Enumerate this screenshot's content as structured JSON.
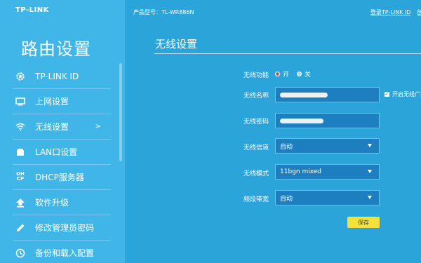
{
  "sidebar": {
    "brand": "TP-LINK",
    "title": "路由设置",
    "items": [
      {
        "label": "TP-LINK ID",
        "icon": "gear-icon"
      },
      {
        "label": "上网设置",
        "icon": "monitor-icon"
      },
      {
        "label": "无线设置",
        "icon": "wifi-icon",
        "arrow": ">",
        "active": true
      },
      {
        "label": "LAN口设置",
        "icon": "lan-icon"
      },
      {
        "label": "DHCP服务器",
        "icon": "dhcp-icon"
      },
      {
        "label": "软件升级",
        "icon": "upgrade-icon"
      },
      {
        "label": "修改管理员密码",
        "icon": "pencil-icon"
      },
      {
        "label": "备份和载入配置",
        "icon": "backup-icon"
      }
    ]
  },
  "header": {
    "product": "产品型号：TL-WR886N",
    "login_link": "登录TP-LINK ID",
    "create_link": "创建"
  },
  "wireless": {
    "section_title": "无线设置",
    "function_label": "无线功能",
    "on_label": "开",
    "off_label": "关",
    "on_selected": true,
    "name_label": "无线名称",
    "broadcast_label": "开启无线广播",
    "broadcast_checked": true,
    "password_label": "无线密码",
    "channel_label": "无线信道",
    "channel_value": "自动",
    "mode_label": "无线模式",
    "mode_value": "11bgn mixed",
    "bandwidth_label": "频段带宽",
    "bandwidth_value": "自动",
    "save_label": "保存"
  },
  "colors": {
    "background": "#2ba4d9",
    "sidebar": "#40b6e8",
    "field": "#1d7fc0",
    "save_button": "#f3e23a"
  }
}
